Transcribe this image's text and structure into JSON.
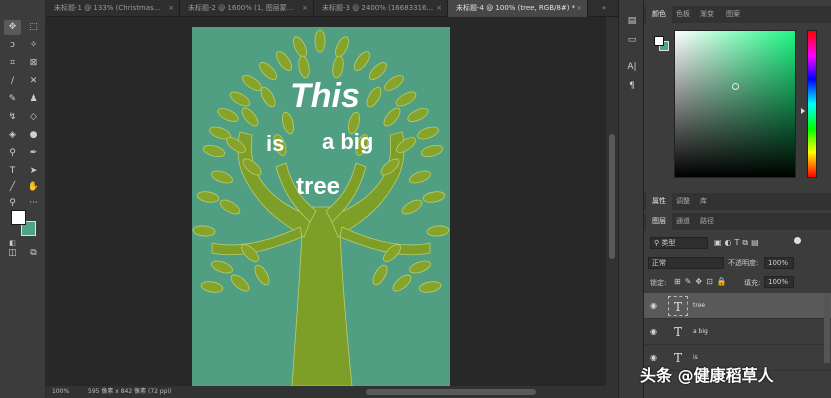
{
  "tabs": [
    {
      "label": "未标题-1 @ 133% (Christmas..."
    },
    {
      "label": "未标题-2 @ 1600% (1, 图层蒙..."
    },
    {
      "label": "未标题-3 @ 2400% (16683316..."
    },
    {
      "label": "未标题-4 @ 100% (tree, RGB/8#) *"
    }
  ],
  "close_glyph": "×",
  "more_glyph": "»",
  "canvas": {
    "title": "This",
    "line2a": "is",
    "line2b": "a big",
    "line3": "tree",
    "bg_color": "#519f83",
    "tree_color": "#7e9f27"
  },
  "status": {
    "zoom": "100%",
    "info": "595 像素 x 842 像素 (72 ppi)"
  },
  "color_panel": {
    "tabs": [
      "颜色",
      "色板",
      "渐变",
      "图案"
    ]
  },
  "props_panel": {
    "tabs": [
      "属性",
      "调整",
      "库"
    ]
  },
  "layers_panel": {
    "tabs": [
      "图层",
      "通道",
      "路径"
    ],
    "kind_label": "类型",
    "blend_mode": "正常",
    "opacity_label": "不透明度:",
    "opacity_value": "100%",
    "lock_label": "锁定:",
    "fill_label": "填充:",
    "fill_value": "100%",
    "layers": [
      {
        "name": "tree",
        "selected": true
      },
      {
        "name": "a big",
        "selected": false
      },
      {
        "name": "is",
        "selected": false
      }
    ]
  },
  "watermark": "头条 @健康稻草人",
  "colors": {
    "accent_bg": "#4fa385",
    "fg": "#ffffff"
  }
}
